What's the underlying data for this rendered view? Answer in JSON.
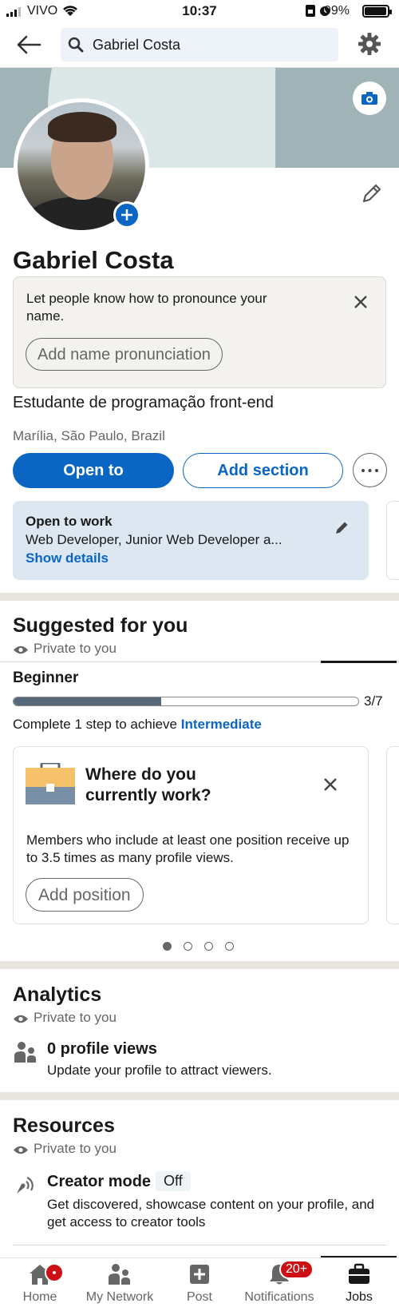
{
  "status_bar": {
    "carrier": "VIVO",
    "time": "10:37",
    "battery_pct": "99%"
  },
  "topbar": {
    "search_value": "Gabriel Costa"
  },
  "profile": {
    "name": "Gabriel Costa",
    "headline": "Estudante de programação front-end",
    "location": "Marília, São Paulo, Brazil"
  },
  "pronunciation": {
    "prompt": "Let people know how to pronounce your name.",
    "button": "Add name pronunciation"
  },
  "actions": {
    "open_to": "Open to",
    "add_section": "Add section"
  },
  "open_to_work": {
    "title": "Open to work",
    "roles": "Web Developer, Junior Web Developer a...",
    "link": "Show details"
  },
  "suggested": {
    "title": "Suggested for you",
    "private": "Private to you",
    "level": "Beginner",
    "progress": 0.4286,
    "progress_label": "3/7",
    "complete_prefix": "Complete 1 step to achieve ",
    "complete_target": "Intermediate",
    "card": {
      "title": "Where do you currently work?",
      "desc": "Members who include at least one position receive up to 3.5 times as many profile views.",
      "button": "Add position"
    },
    "pages": 4,
    "active_page": 0
  },
  "analytics": {
    "title": "Analytics",
    "private": "Private to you",
    "views_title": "0 profile views",
    "views_sub": "Update your profile to attract viewers."
  },
  "resources": {
    "title": "Resources",
    "private": "Private to you",
    "creator_title": "Creator mode",
    "creator_state": "Off",
    "creator_sub": "Get discovered, showcase content on your profile, and get access to creator tools"
  },
  "bottom_nav": {
    "items": [
      {
        "label": "Home"
      },
      {
        "label": "My Network"
      },
      {
        "label": "Post"
      },
      {
        "label": "Notifications",
        "badge": "20+"
      },
      {
        "label": "Jobs"
      }
    ]
  },
  "colors": {
    "brand_blue": "#0a66c2",
    "badge_red": "#cc1016",
    "otw_bg": "#dde7f1"
  }
}
